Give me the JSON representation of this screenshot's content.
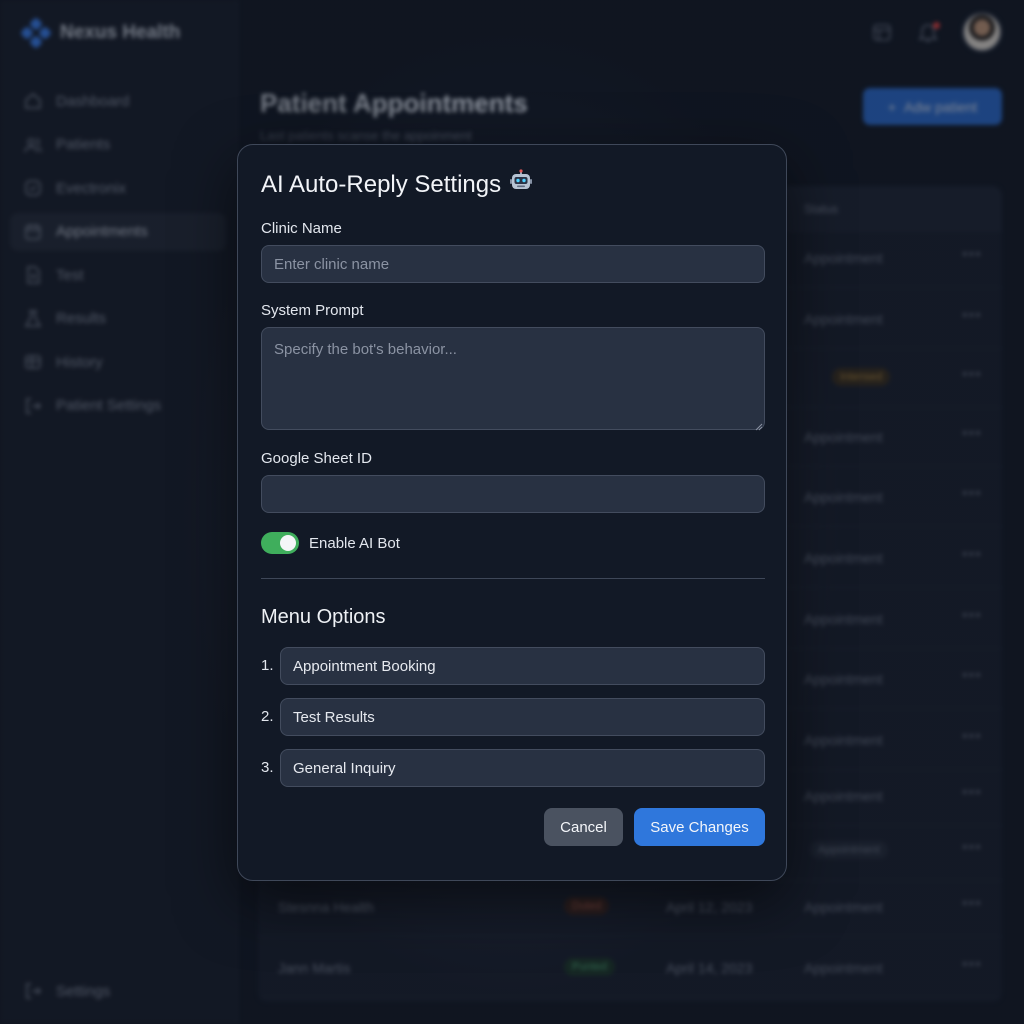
{
  "app": {
    "brand": "Nexus Health",
    "nav": [
      {
        "label": "Dashboard",
        "icon": "home-icon"
      },
      {
        "label": "Patients",
        "icon": "users-icon"
      },
      {
        "label": "Evectronix",
        "icon": "check-badge-icon"
      },
      {
        "label": "Appointments",
        "icon": "calendar-icon",
        "active": true
      },
      {
        "label": "Test",
        "icon": "file-icon"
      },
      {
        "label": "Results",
        "icon": "flask-icon"
      },
      {
        "label": "History",
        "icon": "box-icon"
      },
      {
        "label": "Patient Settings",
        "icon": "logout-icon"
      }
    ],
    "nav_bottom": {
      "label": "Settings",
      "icon": "logout-icon"
    },
    "page_title": "Patient Appointments",
    "page_subtitle": "Last patients scanse the appoinment",
    "add_button": "Adw patient",
    "table": {
      "status_header": "Status",
      "rows": [
        {
          "status": "Appointment"
        },
        {
          "status": "Appointment"
        },
        {
          "badge": "Intensed",
          "badge_style": "warn"
        },
        {
          "status": "Appointment"
        },
        {
          "status": "Appointment"
        },
        {
          "status": "Appointment"
        },
        {
          "status": "Appointment"
        },
        {
          "status": "Appointment"
        },
        {
          "status": "Appointment"
        },
        {
          "status": "Appointment"
        },
        {
          "badge": "Appointment",
          "badge_style": "pill"
        },
        {
          "name": "Stesnna Health",
          "badge": "Duted",
          "badge_style": "red",
          "date": "April 12, 2023",
          "status": "Appointment"
        },
        {
          "name": "Jann Martis",
          "badge": "Punted",
          "badge_style": "green",
          "date": "April 14, 2023",
          "status": "Appointment"
        }
      ],
      "more_glyph": "•••"
    }
  },
  "modal": {
    "title": "AI Auto-Reply Settings",
    "title_emoji_icon": "robot-icon",
    "clinic_name": {
      "label": "Clinic Name",
      "value": "",
      "placeholder": "Enter clinic name"
    },
    "system_prompt": {
      "label": "System Prompt",
      "value": "",
      "placeholder": "Specify the bot's behavior..."
    },
    "sheet_id": {
      "label": "Google Sheet ID",
      "value": "",
      "placeholder": ""
    },
    "enable_bot": {
      "label": "Enable AI Bot",
      "checked": true
    },
    "menu_title": "Menu Options",
    "options": [
      {
        "num": "1.",
        "value": "Appointment Booking"
      },
      {
        "num": "2.",
        "value": "Test Results"
      },
      {
        "num": "3.",
        "value": "General Inquiry"
      }
    ],
    "cancel_label": "Cancel",
    "save_label": "Save Changes"
  },
  "colors": {
    "accent": "#2f77dc",
    "toggle_on": "#3fae5c",
    "modal_bg": "#121926",
    "page_bg": "#141b29"
  }
}
